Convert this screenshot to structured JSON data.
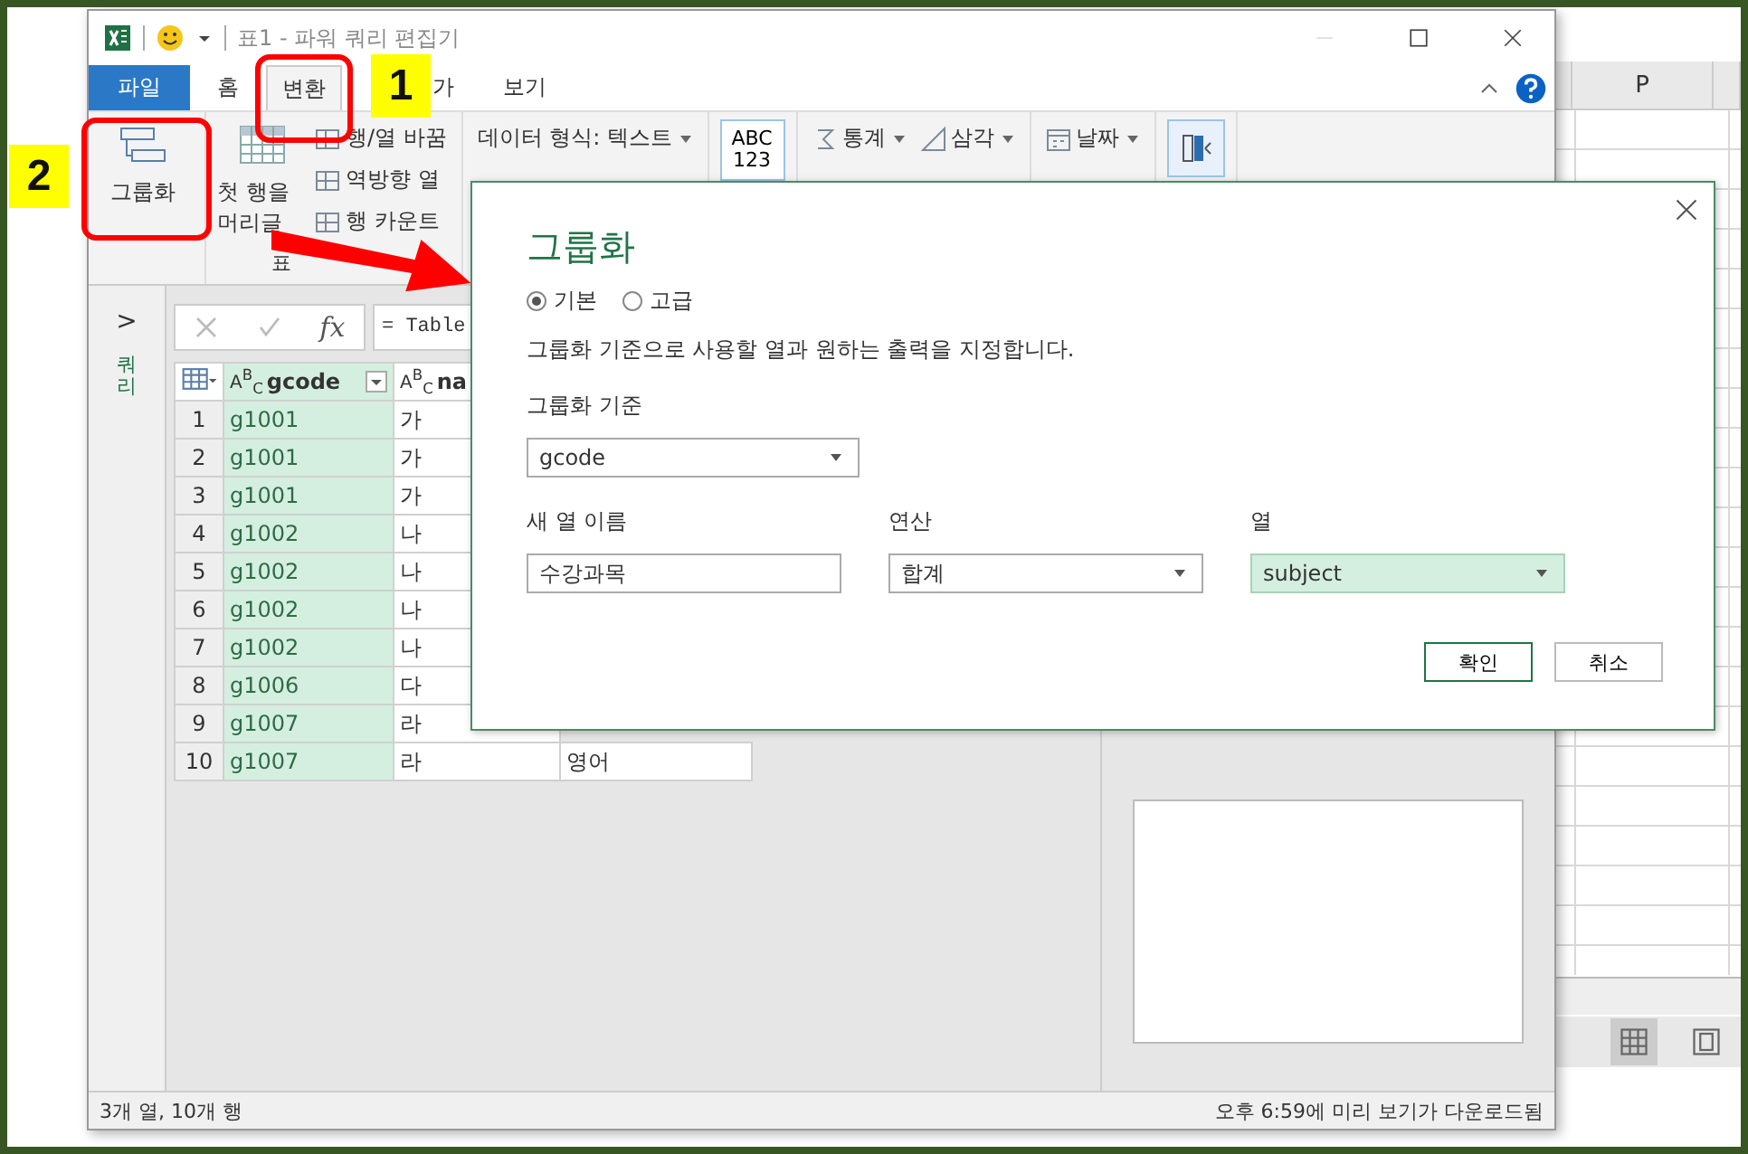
{
  "window": {
    "title": "표1 - 파워 쿼리 편집기"
  },
  "tabs": [
    {
      "label": "파일",
      "kind": "file",
      "selected": false
    },
    {
      "label": "홈",
      "kind": "tab",
      "selected": false
    },
    {
      "label": "변환",
      "kind": "tab",
      "selected": true
    },
    {
      "label": "가",
      "kind": "tab",
      "selected": false
    },
    {
      "label": "보기",
      "kind": "tab",
      "selected": false
    }
  ],
  "ribbon": {
    "group_by": "그룹화",
    "first_row": [
      "첫 행을",
      "머리글"
    ],
    "small_items": [
      "행/열 바꿈",
      "역방향 열",
      "행 카운트"
    ],
    "data_type": "데이터 형식: 텍스트",
    "group_label": "표",
    "type_button": [
      "ABC",
      "123"
    ],
    "stats": "통계",
    "trig": "삼각",
    "date": "날짜"
  },
  "nav": {
    "toggle": ">",
    "label": "쿼리"
  },
  "formula_bar": {
    "fx": "fx",
    "formula": "= Table"
  },
  "table": {
    "columns": [
      {
        "type": "A$^{B}$$_{C}$",
        "name": "gcode",
        "selected": true
      },
      {
        "type": "A$^{B}$$_{C}$",
        "name": "na",
        "selected": false
      }
    ],
    "rows": [
      {
        "num": "1",
        "gcode": "g1001",
        "name": "가"
      },
      {
        "num": "2",
        "gcode": "g1001",
        "name": "가"
      },
      {
        "num": "3",
        "gcode": "g1001",
        "name": "가"
      },
      {
        "num": "4",
        "gcode": "g1002",
        "name": "나"
      },
      {
        "num": "5",
        "gcode": "g1002",
        "name": "나"
      },
      {
        "num": "6",
        "gcode": "g1002",
        "name": "나"
      },
      {
        "num": "7",
        "gcode": "g1002",
        "name": "나"
      },
      {
        "num": "8",
        "gcode": "g1006",
        "name": "다"
      },
      {
        "num": "9",
        "gcode": "g1007",
        "name": "라"
      },
      {
        "num": "10",
        "gcode": "g1007",
        "name": "라",
        "column_3": "영어"
      }
    ]
  },
  "status_bar": {
    "left": "3개 열, 10개 행",
    "right": "오후 6:59에 미리 보기가 다운로드됨"
  },
  "sheet": {
    "column": "P"
  },
  "dialog": {
    "title": "그룹화",
    "modes": [
      {
        "label": "기본",
        "selected": true
      },
      {
        "label": "고급",
        "selected": false
      }
    ],
    "description": "그룹화 기준으로 사용할 열과 원하는 출력을 지정합니다.",
    "group_by_label": "그룹화 기준",
    "group_by": "gcode",
    "fields": [
      {
        "label": "새 열 이름",
        "kind": "input",
        "value": "수강과목",
        "focused": false
      },
      {
        "label": "연산",
        "kind": "select",
        "value": "합계",
        "focused": false
      },
      {
        "label": "열",
        "kind": "select",
        "value": "subject",
        "focused": true
      }
    ],
    "buttons": [
      {
        "label": "확인",
        "default": true
      },
      {
        "label": "취소",
        "default": false
      }
    ]
  },
  "annotations": [
    {
      "label": "1"
    },
    {
      "label": "2"
    }
  ]
}
